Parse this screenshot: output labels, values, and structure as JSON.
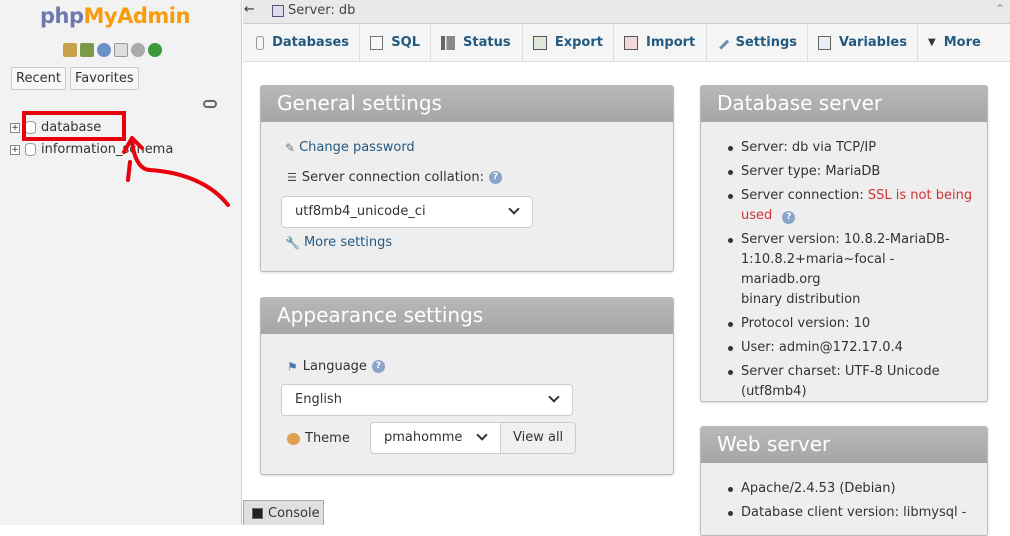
{
  "sidebar": {
    "logo_a": "php",
    "logo_b": "MyAdmin",
    "tabs": {
      "recent": "Recent",
      "favorites": "Favorites"
    },
    "databases": [
      "database",
      "information_schema"
    ]
  },
  "topbar": {
    "breadcrumb": "Server: db"
  },
  "menu": {
    "databases": "Databases",
    "sql": "SQL",
    "status": "Status",
    "export": "Export",
    "import": "Import",
    "settings": "Settings",
    "variables": "Variables",
    "more": "More"
  },
  "general": {
    "title": "General settings",
    "change_password": "Change password",
    "collation_label": "Server connection collation:",
    "collation_value": "utf8mb4_unicode_ci",
    "more_settings": "More settings"
  },
  "appearance": {
    "title": "Appearance settings",
    "language_label": "Language",
    "language_value": "English",
    "theme_label": "Theme",
    "theme_value": "pmahomme",
    "view_all": "View all"
  },
  "db_server": {
    "title": "Database server",
    "server": "Server: db via TCP/IP",
    "type": "Server type: MariaDB",
    "conn_prefix": "Server connection: ",
    "conn_ssl_1": "SSL is not being",
    "conn_ssl_2": "used",
    "version_1": "Server version: 10.8.2-MariaDB-",
    "version_2": "1:10.8.2+maria~focal - mariadb.org",
    "version_3": "binary distribution",
    "protocol": "Protocol version: 10",
    "user": "User: admin@172.17.0.4",
    "charset_1": "Server charset: UTF-8 Unicode",
    "charset_2": "(utf8mb4)"
  },
  "web_server": {
    "title": "Web server",
    "apache": "Apache/2.4.53 (Debian)",
    "client": "Database client version: libmysql -"
  },
  "console": {
    "label": "Console"
  },
  "colors": {
    "link": "#235a81",
    "annotation": "#e8000b",
    "logo_a": "#6c78af",
    "logo_b": "#f89c0e"
  }
}
